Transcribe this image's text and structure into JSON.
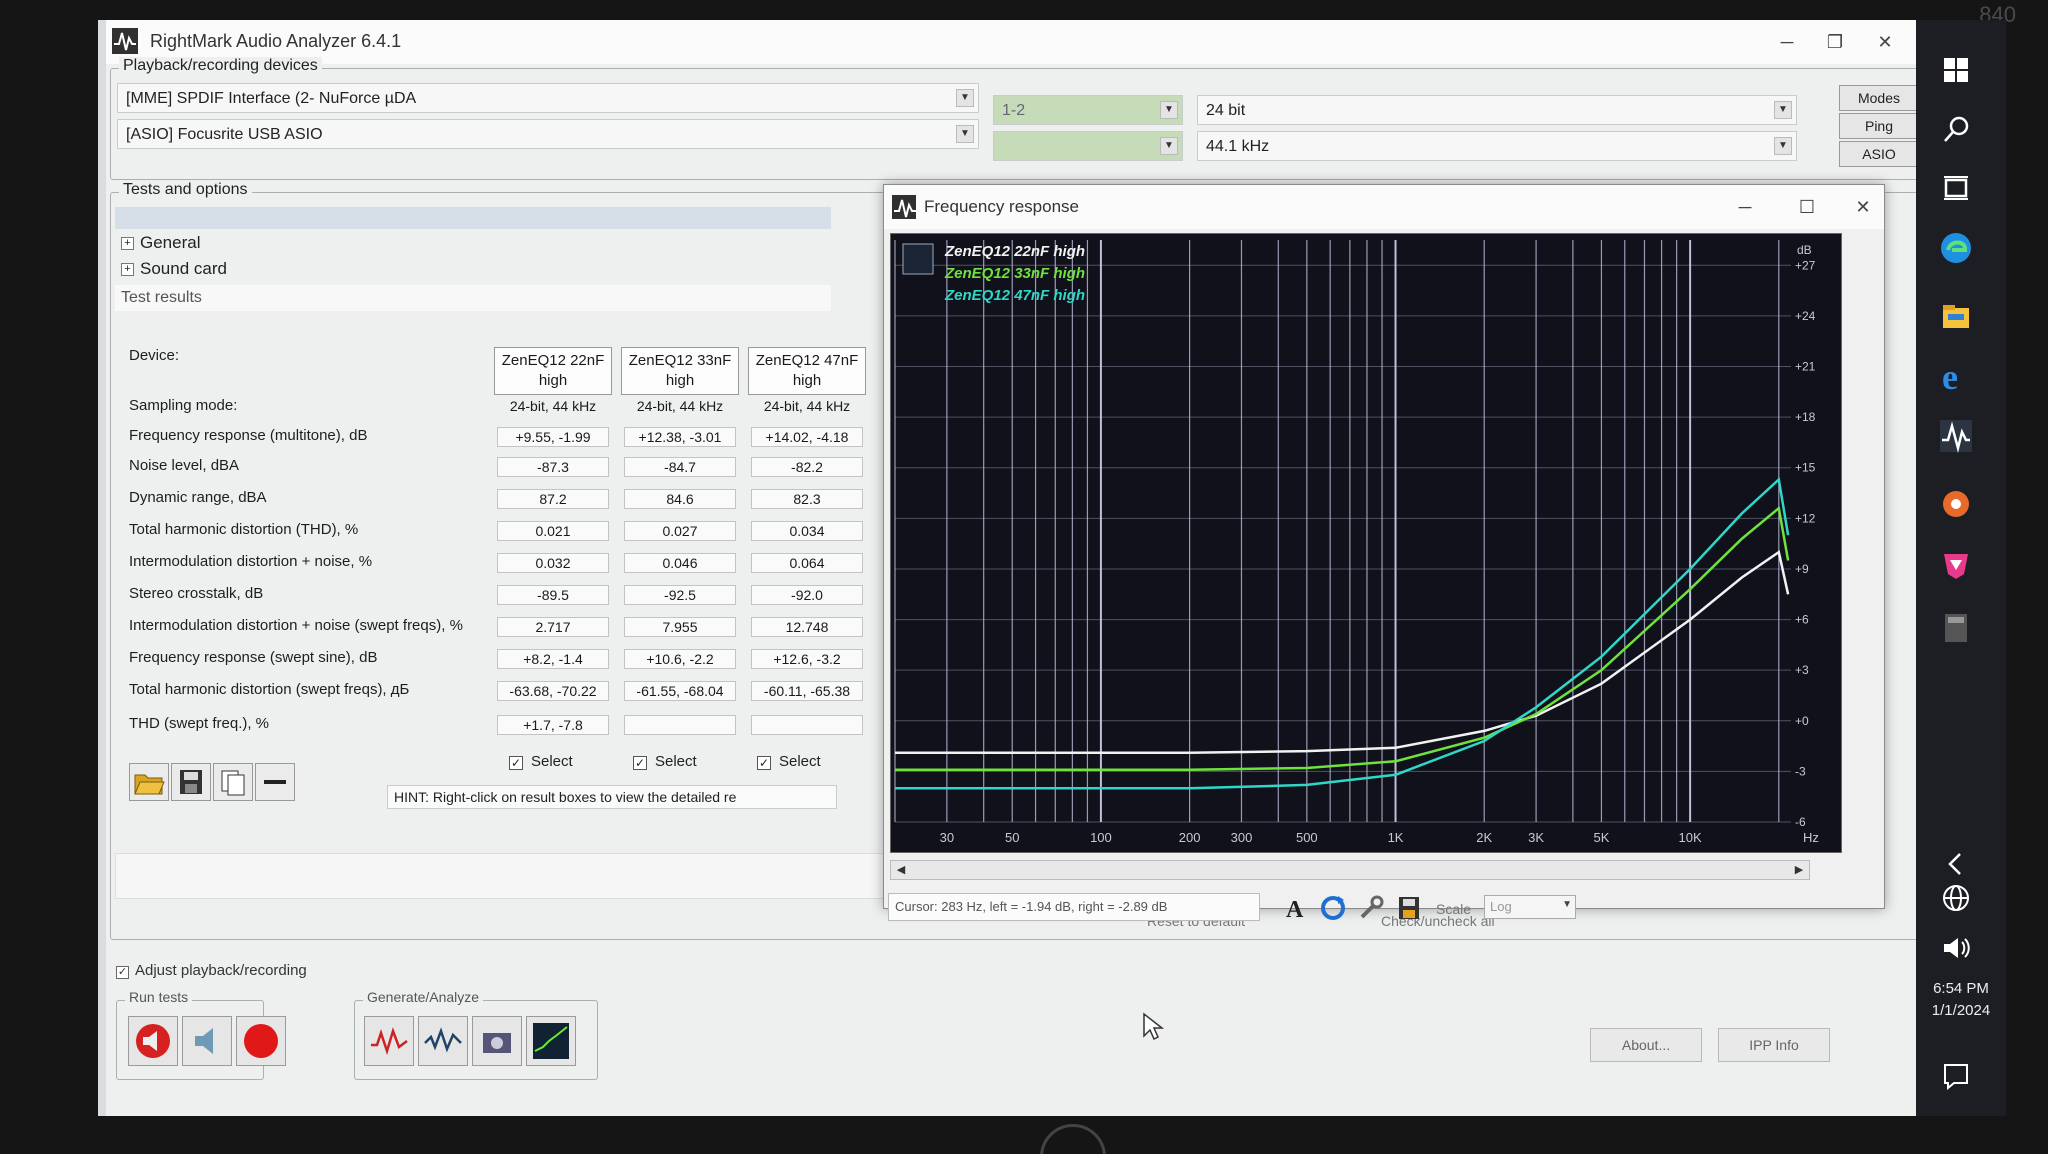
{
  "bezel_text": "840",
  "app": {
    "title": "RightMark Audio Analyzer 6.4.1",
    "controls": {
      "minimize": "─",
      "maximize": "❐",
      "close": "✕"
    }
  },
  "devices": {
    "group_title": "Playback/recording devices",
    "playback": "[MME] SPDIF Interface (2- NuForce µDA",
    "recording": "[ASIO] Focusrite USB ASIO",
    "channels": "1-2",
    "channels2": "",
    "bit_depth": "24 bit",
    "sample_rate": "44.1 kHz",
    "buttons": [
      "Modes",
      "Ping",
      "ASIO"
    ]
  },
  "tests": {
    "group_title": "Tests and options",
    "tree": [
      "General",
      "Sound card"
    ],
    "results_title": "Test results"
  },
  "results": {
    "labels": [
      "Device:",
      "Sampling mode:",
      "Frequency response (multitone), dB",
      "Noise level, dBA",
      "Dynamic range, dBA",
      "Total harmonic distortion (THD), %",
      "Intermodulation distortion + noise, %",
      "Stereo crosstalk, dB",
      "Intermodulation distortion + noise (swept freqs), %",
      "Frequency response (swept sine), dB",
      "Total harmonic distortion (swept freqs), дБ",
      "THD (swept freq.), %"
    ],
    "columns": [
      {
        "device_line1": "ZenEQ12 22nF",
        "device_line2": "high",
        "sampling": "24-bit, 44 kHz",
        "fr_multitone": "+9.55, -1.99",
        "noise": "-87.3",
        "dynamic_range": "87.2",
        "thd": "0.021",
        "imd": "0.032",
        "crosstalk": "-89.5",
        "imd_swept": "2.717",
        "fr_swept": "+8.2, -1.4",
        "thd_swept_db": "-63.68, -70.22",
        "thd_swept_pct": "+1.7, -7.8",
        "select": "Select"
      },
      {
        "device_line1": "ZenEQ12 33nF",
        "device_line2": "high",
        "sampling": "24-bit, 44 kHz",
        "fr_multitone": "+12.38, -3.01",
        "noise": "-84.7",
        "dynamic_range": "84.6",
        "thd": "0.027",
        "imd": "0.046",
        "crosstalk": "-92.5",
        "imd_swept": "7.955",
        "fr_swept": "+10.6, -2.2",
        "thd_swept_db": "-61.55, -68.04",
        "thd_swept_pct": "",
        "select": "Select"
      },
      {
        "device_line1": "ZenEQ12 47nF",
        "device_line2": "high",
        "sampling": "24-bit, 44 kHz",
        "fr_multitone": "+14.02, -4.18",
        "noise": "-82.2",
        "dynamic_range": "82.3",
        "thd": "0.034",
        "imd": "0.064",
        "crosstalk": "-92.0",
        "imd_swept": "12.748",
        "fr_swept": "+12.6, -3.2",
        "thd_swept_db": "-60.11, -65.38",
        "thd_swept_pct": "",
        "select": "Select"
      }
    ],
    "hint": "HINT: Right-click on result boxes to view the detailed re"
  },
  "bottom": {
    "adjust": "Adjust playback/recording",
    "run_tests": "Run tests",
    "generate": "Generate/Analyze",
    "reset": "Reset to default",
    "check_all": "Check/uncheck all",
    "about": "About...",
    "ipp": "IPP Info"
  },
  "fr_window": {
    "title": "Frequency response",
    "cursor": "Cursor:  283 Hz,  left = -1.94 dB,  right = -2.89 dB",
    "scale_label": "Scale",
    "scale_value": "Log"
  },
  "chart_data": {
    "type": "line",
    "title": "",
    "xlabel": "Hz",
    "ylabel": "dB",
    "x_scale": "log",
    "xlim": [
      20,
      22000
    ],
    "ylim": [
      -6,
      28.5
    ],
    "x_ticks": [
      30,
      50,
      100,
      200,
      300,
      500,
      1000,
      2000,
      3000,
      5000,
      10000
    ],
    "x_tick_labels": [
      "30",
      "50",
      "100",
      "200",
      "300",
      "500",
      "1K",
      "2K",
      "3K",
      "5K",
      "10K"
    ],
    "y_ticks": [
      -6,
      -3,
      0,
      3,
      6,
      9,
      12,
      15,
      18,
      21,
      24,
      27
    ],
    "y_tick_labels": [
      "-6",
      "-3",
      "+0",
      "+3",
      "+6",
      "+9",
      "+12",
      "+15",
      "+18",
      "+21",
      "+24",
      "+27"
    ],
    "grid": true,
    "legend_position": "top-left",
    "series": [
      {
        "name": "ZenEQ12 22nF high",
        "color": "#f2f2f2",
        "x": [
          20,
          50,
          100,
          200,
          500,
          1000,
          2000,
          3000,
          5000,
          10000,
          15000,
          20000,
          21500
        ],
        "y": [
          -1.9,
          -1.9,
          -1.9,
          -1.9,
          -1.8,
          -1.6,
          -0.6,
          0.3,
          2.2,
          6.0,
          8.5,
          10.0,
          7.5
        ]
      },
      {
        "name": "ZenEQ12 33nF high",
        "color": "#6ee33c",
        "x": [
          20,
          50,
          100,
          200,
          500,
          1000,
          2000,
          3000,
          5000,
          10000,
          15000,
          20000,
          21500
        ],
        "y": [
          -2.9,
          -2.9,
          -2.9,
          -2.9,
          -2.8,
          -2.4,
          -1.0,
          0.4,
          3.0,
          7.8,
          10.8,
          12.6,
          9.5
        ]
      },
      {
        "name": "ZenEQ12 47nF high",
        "color": "#2fd7c7",
        "x": [
          20,
          50,
          100,
          200,
          500,
          1000,
          2000,
          3000,
          5000,
          10000,
          15000,
          20000,
          21500
        ],
        "y": [
          -4.0,
          -4.0,
          -4.0,
          -4.0,
          -3.8,
          -3.2,
          -1.2,
          0.8,
          3.8,
          9.0,
          12.3,
          14.3,
          11.0
        ]
      }
    ]
  },
  "taskbar": {
    "time": "6:54 PM",
    "date": "1/1/2024"
  },
  "colors": {
    "plot_bg": "#11111c",
    "grid": "#c7c9e6",
    "taskbar": "#1d1e24"
  }
}
